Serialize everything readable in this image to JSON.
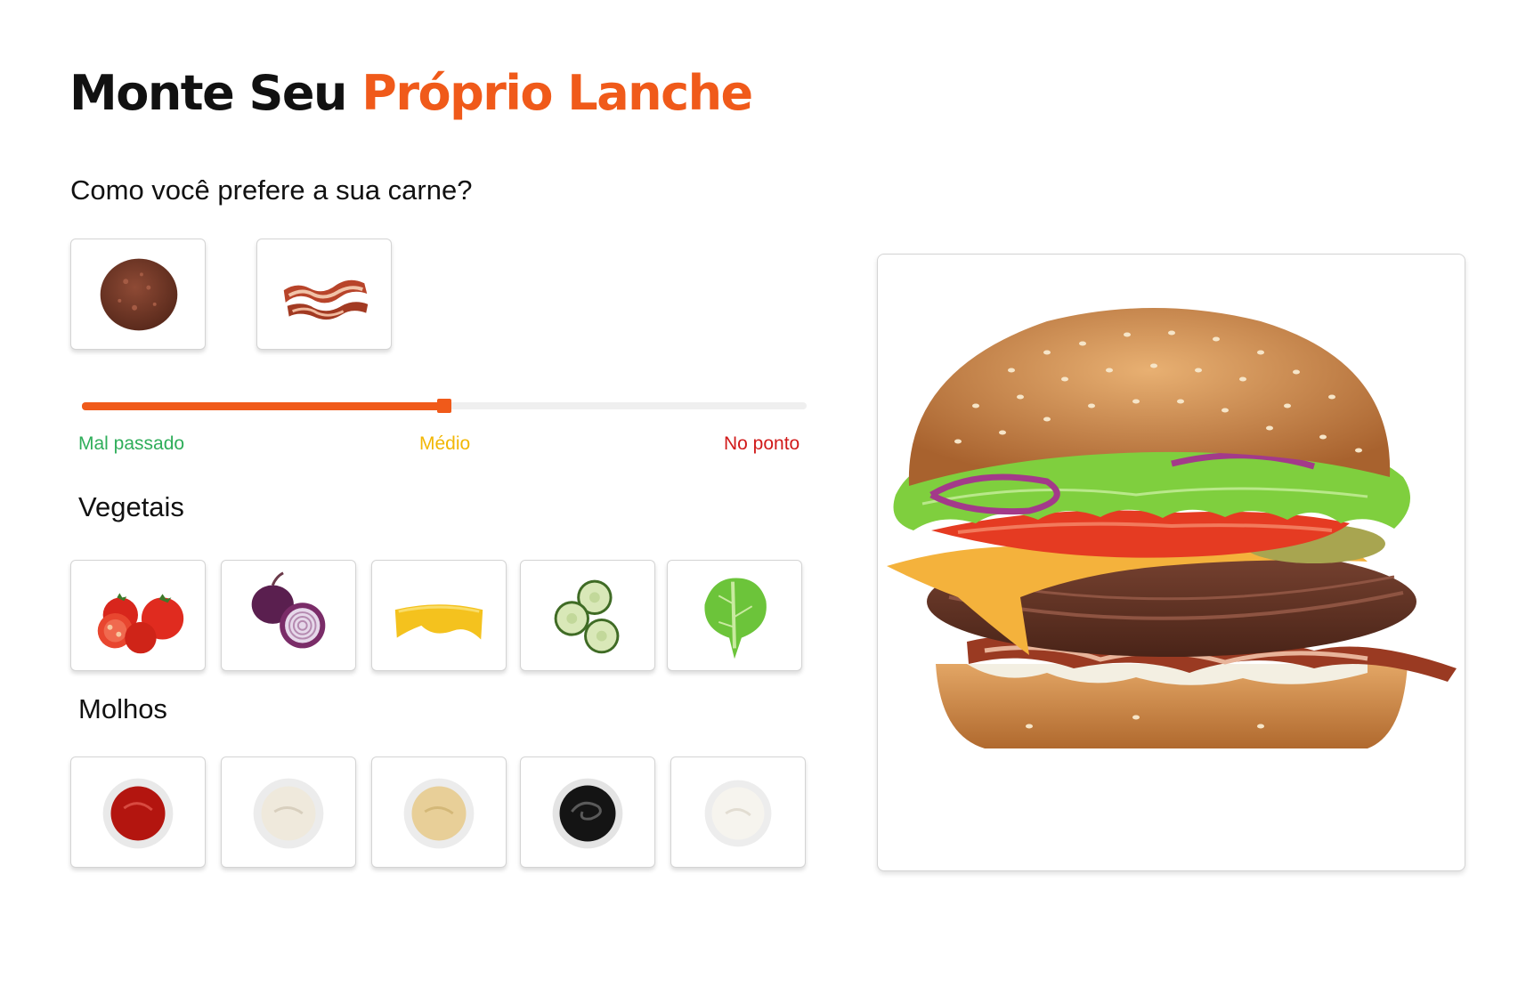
{
  "header": {
    "title_part1": "Monte Seu ",
    "title_part2": "Próprio Lanche"
  },
  "meat": {
    "question": "Como você prefere a sua carne?",
    "options": [
      {
        "name": "beef-patty"
      },
      {
        "name": "bacon"
      }
    ]
  },
  "doneness": {
    "value": 0.5,
    "levels": [
      {
        "label": "Mal passado",
        "color": "#2fae5a"
      },
      {
        "label": "Médio",
        "color": "#f2b705"
      },
      {
        "label": "No ponto",
        "color": "#d11a1a"
      }
    ]
  },
  "vegetables": {
    "title": "Vegetais",
    "items": [
      {
        "name": "tomato"
      },
      {
        "name": "red-onion"
      },
      {
        "name": "cheese"
      },
      {
        "name": "cucumber"
      },
      {
        "name": "lettuce"
      }
    ]
  },
  "sauces": {
    "title": "Molhos",
    "items": [
      {
        "name": "ketchup"
      },
      {
        "name": "mayonnaise"
      },
      {
        "name": "mustard"
      },
      {
        "name": "barbecue"
      },
      {
        "name": "cream-sauce"
      }
    ]
  },
  "preview": {
    "name": "burger-preview"
  },
  "colors": {
    "accent": "#f05a1a",
    "text": "#111111",
    "card_border": "#d4d4d4"
  }
}
